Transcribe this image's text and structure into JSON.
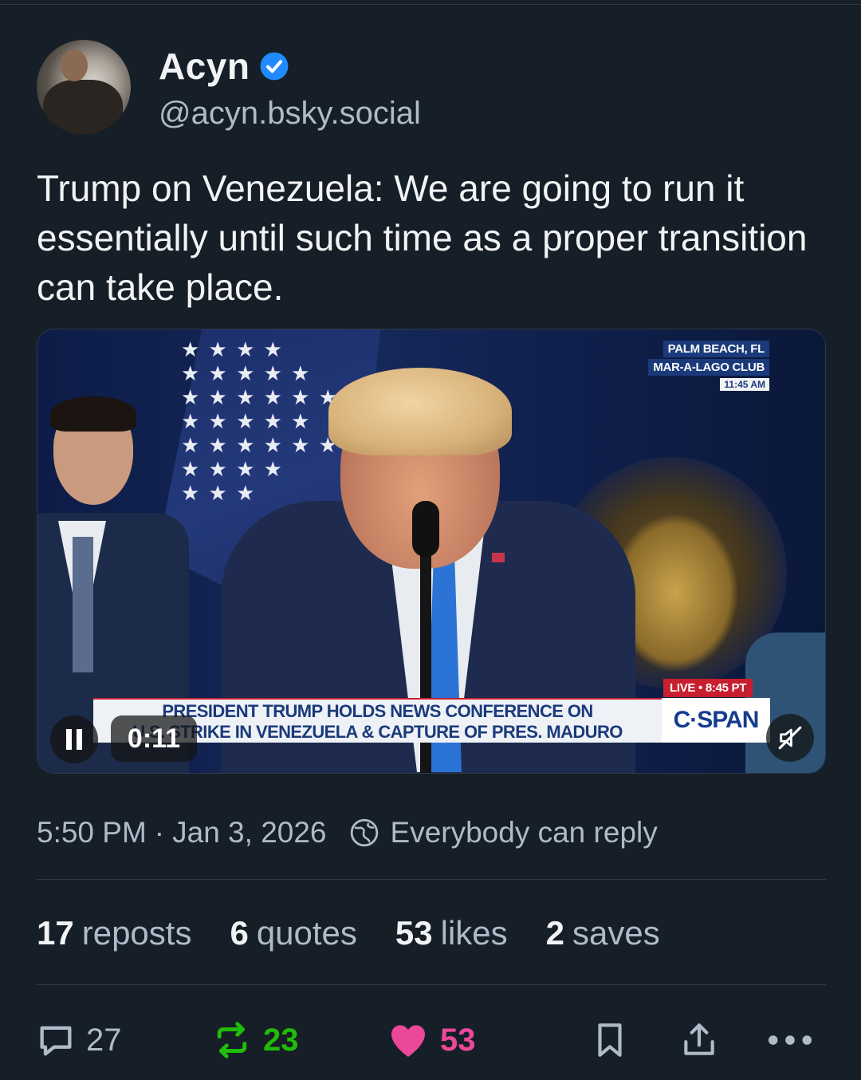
{
  "author": {
    "display_name": "Acyn",
    "handle": "@acyn.bsky.social",
    "verified": true
  },
  "post": {
    "text": "Trump on Venezuela: We are going to run it essentially until such time as a proper transition can take place.",
    "timestamp": "5:50 PM · Jan 3, 2026",
    "time": "5:50 PM",
    "date": "Jan 3, 2026",
    "reply_setting": "Everybody can reply"
  },
  "video": {
    "location_line1": "PALM BEACH, FL",
    "location_line2": "MAR-A-LAGO CLUB",
    "location_time": "11:45 AM",
    "live_label": "LIVE • 8:45 PT",
    "network": "C·SPAN",
    "lower_third_line1": "PRESIDENT TRUMP HOLDS NEWS CONFERENCE ON",
    "lower_third_line2": "U.S. STRIKE IN VENEZUELA & CAPTURE OF PRES. MADURO",
    "elapsed": "0:11",
    "playing": true,
    "muted": true
  },
  "stats": {
    "reposts": {
      "count": "17",
      "label": "reposts"
    },
    "quotes": {
      "count": "6",
      "label": "quotes"
    },
    "likes": {
      "count": "53",
      "label": "likes"
    },
    "saves": {
      "count": "2",
      "label": "saves"
    }
  },
  "actions": {
    "replies": "27",
    "reposts": "23",
    "likes": "53"
  },
  "colors": {
    "background": "#161e27",
    "text_primary": "#f1f3f5",
    "text_secondary": "#aebbc9",
    "verified_blue": "#208bfe",
    "repost_green": "#20bc07",
    "like_pink": "#ec4899",
    "divider": "#2e3a47"
  },
  "icons": [
    "verified-badge-icon",
    "pause-icon",
    "muted-speaker-icon",
    "globe-icon",
    "reply-icon",
    "repost-icon",
    "heart-icon",
    "bookmark-icon",
    "share-icon",
    "more-icon"
  ]
}
